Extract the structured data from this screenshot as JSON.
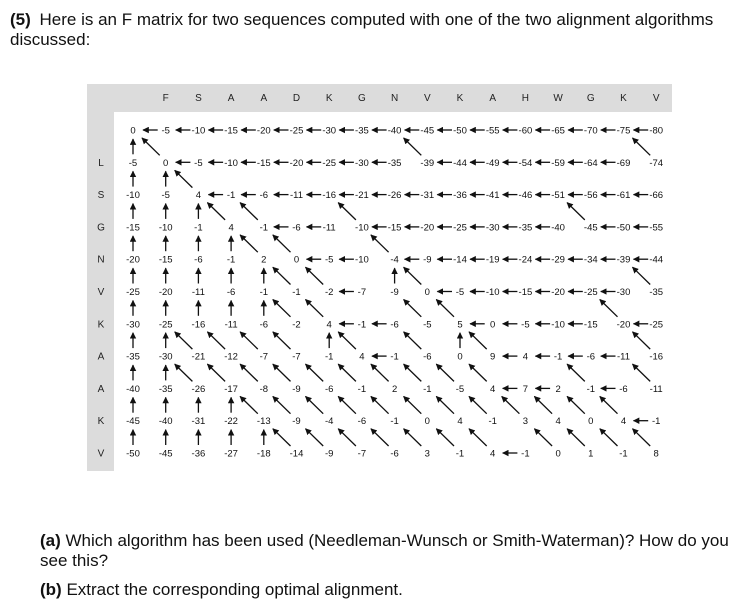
{
  "question": {
    "number": "(5)",
    "text": "Here is an F matrix for two sequences computed with one of the two alignment algorithms discussed:"
  },
  "matrix": {
    "col_labels": [
      "F",
      "S",
      "A",
      "A",
      "D",
      "K",
      "G",
      "N",
      "V",
      "K",
      "A",
      "H",
      "W",
      "G",
      "K",
      "V"
    ],
    "row_labels": [
      "L",
      "S",
      "G",
      "N",
      "V",
      "K",
      "A",
      "A",
      "K",
      "V"
    ],
    "rows": [
      {
        "values": [
          "0",
          "-5",
          "-10",
          "-15",
          "-20",
          "-25",
          "-30",
          "-35",
          "-40",
          "-45",
          "-50",
          "-55",
          "-60",
          "-65",
          "-70",
          "-75",
          "-80"
        ],
        "arrows": [
          "",
          "L",
          "L",
          "L",
          "L",
          "L",
          "L",
          "L",
          "L",
          "L",
          "L",
          "L",
          "L",
          "L",
          "L",
          "L",
          "L"
        ]
      },
      {
        "values": [
          "-5",
          "0",
          "-5",
          "-10",
          "-15",
          "-20",
          "-25",
          "-30",
          "-35",
          "-39",
          "-44",
          "-49",
          "-54",
          "-59",
          "-64",
          "-69",
          "-74"
        ],
        "arrows": [
          "U",
          "D",
          "L",
          "L",
          "L",
          "L",
          "L",
          "L",
          "L",
          "D",
          "L",
          "L",
          "L",
          "L",
          "L",
          "L",
          "D"
        ]
      },
      {
        "values": [
          "-10",
          "-5",
          "4",
          "-1",
          "-6",
          "-11",
          "-16",
          "-21",
          "-26",
          "-31",
          "-36",
          "-41",
          "-46",
          "-51",
          "-56",
          "-61",
          "-66"
        ],
        "arrows": [
          "U",
          "U",
          "D",
          "L",
          "L",
          "L",
          "L",
          "L",
          "L",
          "L",
          "L",
          "L",
          "L",
          "L",
          "L",
          "L",
          "L"
        ]
      },
      {
        "values": [
          "-15",
          "-10",
          "-1",
          "4",
          "-1",
          "-6",
          "-11",
          "-10",
          "-15",
          "-20",
          "-25",
          "-30",
          "-35",
          "-40",
          "-45",
          "-50",
          "-55"
        ],
        "arrows": [
          "U",
          "U",
          "U",
          "D",
          "D",
          "L",
          "L",
          "D",
          "L",
          "L",
          "L",
          "L",
          "L",
          "L",
          "D",
          "L",
          "L"
        ]
      },
      {
        "values": [
          "-20",
          "-15",
          "-6",
          "-1",
          "2",
          "0",
          "-5",
          "-10",
          "-4",
          "-9",
          "-14",
          "-19",
          "-24",
          "-29",
          "-34",
          "-39",
          "-44"
        ],
        "arrows": [
          "U",
          "U",
          "U",
          "U",
          "D",
          "D",
          "L",
          "L",
          "D",
          "L",
          "L",
          "L",
          "L",
          "L",
          "L",
          "L",
          "L"
        ]
      },
      {
        "values": [
          "-25",
          "-20",
          "-11",
          "-6",
          "-1",
          "-1",
          "-2",
          "-7",
          "-9",
          "0",
          "-5",
          "-10",
          "-15",
          "-20",
          "-25",
          "-30",
          "-35"
        ],
        "arrows": [
          "U",
          "U",
          "U",
          "U",
          "U",
          "D",
          "D",
          "L",
          "U",
          "D",
          "L",
          "L",
          "L",
          "L",
          "L",
          "L",
          "D"
        ]
      },
      {
        "values": [
          "-30",
          "-25",
          "-16",
          "-11",
          "-6",
          "-2",
          "4",
          "-1",
          "-6",
          "-5",
          "5",
          "0",
          "-5",
          "-10",
          "-15",
          "-20",
          "-25"
        ],
        "arrows": [
          "U",
          "U",
          "U",
          "U",
          "U",
          "D",
          "D",
          "L",
          "L",
          "D",
          "D",
          "L",
          "L",
          "L",
          "L",
          "D",
          "L"
        ]
      },
      {
        "values": [
          "-35",
          "-30",
          "-21",
          "-12",
          "-7",
          "-7",
          "-1",
          "4",
          "-1",
          "-6",
          "0",
          "9",
          "4",
          "-1",
          "-6",
          "-11",
          "-16"
        ],
        "arrows": [
          "U",
          "U",
          "D",
          "D",
          "D",
          "D",
          "U",
          "D",
          "L",
          "D",
          "U",
          "D",
          "L",
          "L",
          "L",
          "L",
          "D"
        ]
      },
      {
        "values": [
          "-40",
          "-35",
          "-26",
          "-17",
          "-8",
          "-9",
          "-6",
          "-1",
          "2",
          "-1",
          "-5",
          "4",
          "7",
          "2",
          "-1",
          "-6",
          "-11"
        ],
        "arrows": [
          "U",
          "U",
          "D",
          "D",
          "D",
          "D",
          "D",
          "D",
          "D",
          "D",
          "D",
          "D",
          "L",
          "L",
          "D",
          "L",
          "D"
        ]
      },
      {
        "values": [
          "-45",
          "-40",
          "-31",
          "-22",
          "-13",
          "-9",
          "-4",
          "-6",
          "-1",
          "0",
          "4",
          "-1",
          "3",
          "4",
          "0",
          "4",
          "-1"
        ],
        "arrows": [
          "U",
          "U",
          "U",
          "U",
          "D",
          "D",
          "D",
          "D",
          "D",
          "D",
          "D",
          "D",
          "D",
          "D",
          "D",
          "D",
          "L"
        ]
      },
      {
        "values": [
          "-50",
          "-45",
          "-36",
          "-27",
          "-18",
          "-14",
          "-9",
          "-7",
          "-6",
          "3",
          "-1",
          "4",
          "-1",
          "0",
          "1",
          "-1",
          "8"
        ],
        "arrows": [
          "U",
          "U",
          "U",
          "U",
          "U",
          "D",
          "D",
          "D",
          "D",
          "D",
          "D",
          "D",
          "L",
          "D",
          "D",
          "D",
          "D"
        ]
      }
    ]
  },
  "part_a": {
    "label": "(a)",
    "text": "Which algorithm has been used (Needleman-Wunsch or Smith-Waterman)? How do you see this?"
  },
  "part_b": {
    "label": "(b)",
    "text": "Extract the corresponding optimal alignment."
  }
}
